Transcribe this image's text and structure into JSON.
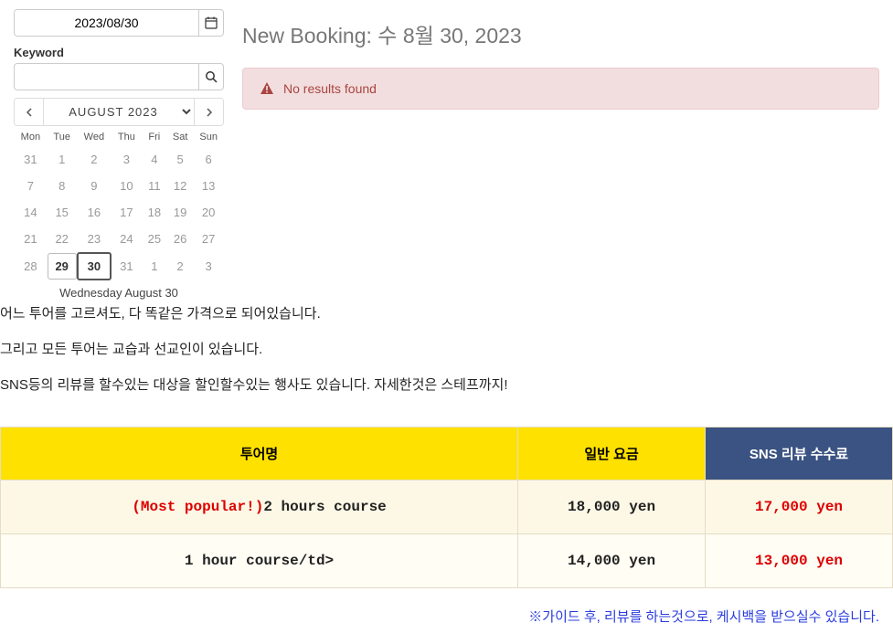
{
  "sidebar": {
    "date_value": "2023/08/30",
    "keyword_label": "Keyword",
    "keyword_value": "",
    "month_label": "AUGUST 2023",
    "days": [
      "Mon",
      "Tue",
      "Wed",
      "Thu",
      "Fri",
      "Sat",
      "Sun"
    ],
    "weeks": [
      [
        {
          "n": "31",
          "in": false
        },
        {
          "n": "1",
          "in": false
        },
        {
          "n": "2",
          "in": false
        },
        {
          "n": "3",
          "in": false
        },
        {
          "n": "4",
          "in": false
        },
        {
          "n": "5",
          "in": false
        },
        {
          "n": "6",
          "in": false
        }
      ],
      [
        {
          "n": "7",
          "in": false
        },
        {
          "n": "8",
          "in": false
        },
        {
          "n": "9",
          "in": false
        },
        {
          "n": "10",
          "in": false
        },
        {
          "n": "11",
          "in": false
        },
        {
          "n": "12",
          "in": false
        },
        {
          "n": "13",
          "in": false
        }
      ],
      [
        {
          "n": "14",
          "in": false
        },
        {
          "n": "15",
          "in": false
        },
        {
          "n": "16",
          "in": false
        },
        {
          "n": "17",
          "in": false
        },
        {
          "n": "18",
          "in": false
        },
        {
          "n": "19",
          "in": false
        },
        {
          "n": "20",
          "in": false
        }
      ],
      [
        {
          "n": "21",
          "in": false
        },
        {
          "n": "22",
          "in": false
        },
        {
          "n": "23",
          "in": false
        },
        {
          "n": "24",
          "in": false
        },
        {
          "n": "25",
          "in": false
        },
        {
          "n": "26",
          "in": false
        },
        {
          "n": "27",
          "in": false
        }
      ],
      [
        {
          "n": "28",
          "in": false
        },
        {
          "n": "29",
          "in": true,
          "bordered": true
        },
        {
          "n": "30",
          "in": true,
          "selected": true
        },
        {
          "n": "31",
          "in": false
        },
        {
          "n": "1",
          "in": false
        },
        {
          "n": "2",
          "in": false
        },
        {
          "n": "3",
          "in": false
        }
      ]
    ],
    "footer": "Wednesday August 30"
  },
  "main": {
    "title": "New Booking: 수 8월 30, 2023",
    "alert": "No results found"
  },
  "intro": {
    "l1": "어느 투어를 고르셔도, 다 똑같은 가격으로 되어있습니다.",
    "l2": "그리고 모든 투어는 교습과 선교인이 있습니다.",
    "l3": "SNS등의 리뷰를 할수있는 대상을 할인할수있는 행사도 있습니다. 자세한것은 스테프까지!"
  },
  "table": {
    "h1": "투어명",
    "h2": "일반 요금",
    "h3": "SNS 리뷰 수수료",
    "rows": [
      {
        "popular": "(Most popular!)",
        "name": "2 hours course",
        "price": "18,000 yen",
        "sns": "17,000 yen"
      },
      {
        "popular": "",
        "name": "1 hour course/td>",
        "price": "14,000 yen",
        "sns": "13,000 yen"
      }
    ]
  },
  "footnote": "※가이드 후, 리뷰를 하는것으로, 케시백을 받으실수 있습니다."
}
